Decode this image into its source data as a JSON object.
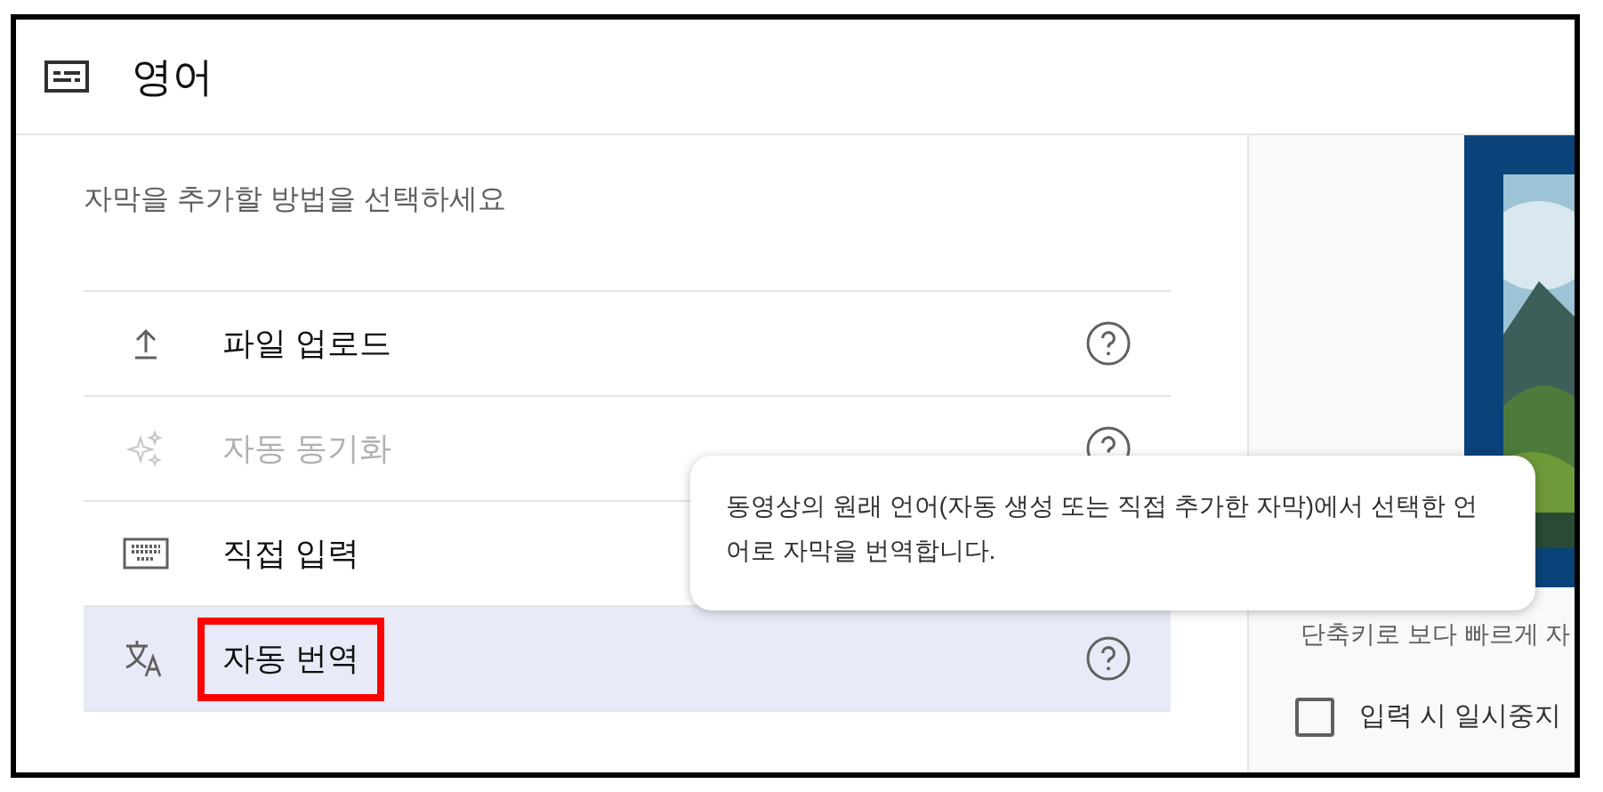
{
  "header": {
    "title": "영어"
  },
  "prompt": "자막을 추가할 방법을 선택하세요",
  "options": [
    {
      "kind": "upload",
      "label": "파일 업로드",
      "disabled": false,
      "selected": false,
      "highlighted": false
    },
    {
      "kind": "sparkle",
      "label": "자동 동기화",
      "disabled": true,
      "selected": false,
      "highlighted": false
    },
    {
      "kind": "keyboard",
      "label": "직접 입력",
      "disabled": false,
      "selected": false,
      "highlighted": false
    },
    {
      "kind": "translate",
      "label": "자동 번역",
      "disabled": false,
      "selected": true,
      "highlighted": true
    }
  ],
  "tooltip": "동영상의 원래 언어(자동 생성 또는 직접 추가한 자막)에서 선택한 언어로 자막을 번역합니다.",
  "side": {
    "shortcut_text": "단축키로 보다 빠르게 자",
    "pause_checkbox": {
      "label": "입력 시 일시중지",
      "checked": false
    }
  }
}
